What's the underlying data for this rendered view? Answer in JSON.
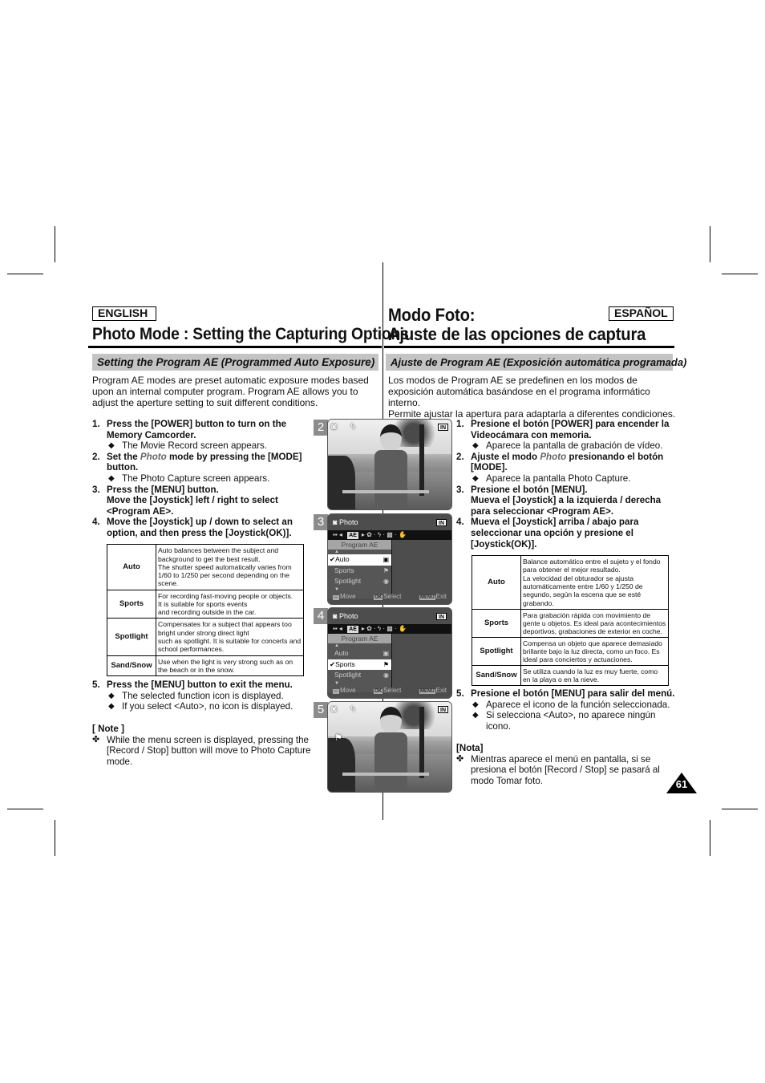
{
  "english": {
    "lang_label": "ENGLISH",
    "title": "Photo Mode : Setting the Capturing Options",
    "section": "Setting the Program AE (Programmed Auto Exposure)",
    "intro": "Program AE modes are preset automatic exposure modes based upon an internal computer program. Program AE allows you to adjust the aperture setting to suit different conditions.",
    "steps": [
      {
        "num": "1.",
        "text": "Press the [POWER] button to turn on the Memory Camcorder.",
        "bullets": [
          "The Movie Record screen appears."
        ]
      },
      {
        "num": "2.",
        "text_pre": "Set the ",
        "photo_word": "Photo",
        "text_post": " mode by pressing the [MODE] button.",
        "bullets": [
          "The Photo Capture screen appears."
        ]
      },
      {
        "num": "3.",
        "text": "Press the [MENU] button.",
        "text2": "Move the [Joystick] left / right to select <Program AE>.",
        "bullets": []
      },
      {
        "num": "4.",
        "text": "Move the [Joystick] up / down to select an option, and then press the [Joystick(OK)].",
        "bullets": []
      },
      {
        "num": "5.",
        "text": "Press the [MENU] button to exit the menu.",
        "bullets": [
          "The selected function icon is displayed.",
          "If you select <Auto>, no icon is displayed."
        ]
      }
    ],
    "modes": [
      {
        "name": "Auto",
        "desc": "Auto balances between the subject and background to get the best result.\nThe shutter speed automatically varies from 1/60 to 1/250 per second depending on the scene."
      },
      {
        "name": "Sports",
        "desc": "For recording fast-moving people or objects.\nIt is suitable for sports events\nand recording outside in the car."
      },
      {
        "name": "Spotlight",
        "desc": "Compensates for a subject that appears too bright under strong direct light\nsuch as spotlight. It is suitable for concerts and school performances."
      },
      {
        "name": "Sand/Snow",
        "desc": "Use when the light is very strong such as on the beach or in the snow."
      }
    ],
    "note_heading": "[ Note ]",
    "note_text": "While the menu screen is displayed, pressing the [Record / Stop] button will move to Photo Capture mode."
  },
  "spanish": {
    "lang_label": "ESPAÑOL",
    "title_line1": "Modo Foto:",
    "title_line2": "Ajuste de las opciones de captura",
    "section": "Ajuste de Program AE (Exposición automática programada)",
    "intro": "Los modos de Program AE se predefinen en los modos de exposición automática basándose en el programa informático interno.\nPermite ajustar la apertura para adaptarla a diferentes condiciones.",
    "steps": [
      {
        "num": "1.",
        "text": "Presione el botón [POWER] para encender la Videocámara con memoria.",
        "bullets": [
          "Aparece la pantalla de grabación de vídeo."
        ]
      },
      {
        "num": "2.",
        "text_pre": "Ajuste el modo ",
        "photo_word": "Photo",
        "text_post": " presionando el botón [MODE].",
        "bullets": [
          "Aparece la pantalla Photo Capture."
        ]
      },
      {
        "num": "3.",
        "text": "Presione el botón [MENU].",
        "text2": "Mueva el [Joystick] a la izquierda / derecha para seleccionar <Program AE>.",
        "bullets": []
      },
      {
        "num": "4.",
        "text": "Mueva el [Joystick] arriba / abajo para seleccionar una opción y presione el [Joystick(OK)].",
        "bullets": []
      },
      {
        "num": "5.",
        "text": "Presione el botón [MENU] para salir del menú.",
        "bullets": [
          "Aparece el icono de la función seleccionada.",
          "Si selecciona <Auto>, no aparece ningún icono."
        ]
      }
    ],
    "modes": [
      {
        "name": "Auto",
        "desc": "Balance automático entre el sujeto y el fondo para obtener el mejor resultado.\nLa velocidad del obturador se ajusta automáticamente entre 1/60 y 1/250 de segundo, según la escena que se esté grabando."
      },
      {
        "name": "Sports",
        "desc": "Para grabación rápida con movimiento de gente u objetos. Es ideal para acontecimientos deportivos, grabaciones de exterior en coche."
      },
      {
        "name": "Spotlight",
        "desc": "Compensa un objeto que aparece demasiado brillante bajo la luz directa, como un foco. Es ideal para conciertos y actuaciones."
      },
      {
        "name": "Sand/Snow",
        "desc": "Se utiliza cuando la luz es muy fuerte, como en la playa o en la nieve."
      }
    ],
    "note_heading": "[Nota]",
    "note_text": "Mientras aparece el menú en pantalla, si se presiona el botón [Record / Stop] se pasará al modo Tomar foto."
  },
  "screens": {
    "s2": {
      "num": "2",
      "battery": "IN"
    },
    "s3": {
      "num": "3",
      "mode_label": "Photo",
      "battery": "IN",
      "ae_label": "AE",
      "menu_title": "Program AE",
      "items": [
        "Auto",
        "Sports",
        "Spotlight"
      ],
      "selected": "Auto",
      "check": "✔",
      "move": "Move",
      "select_key": "OK",
      "select": "Select",
      "exit_key": "MENU",
      "exit": "Exit"
    },
    "s4": {
      "num": "4",
      "mode_label": "Photo",
      "battery": "IN",
      "ae_label": "AE",
      "menu_title": "Program AE",
      "items": [
        "Auto",
        "Sports",
        "Spotlight"
      ],
      "selected": "Sports",
      "check": "✔",
      "move": "Move",
      "select_key": "OK",
      "select": "Select",
      "exit_key": "MENU",
      "exit": "Exit"
    },
    "s5": {
      "num": "5",
      "battery": "IN"
    }
  },
  "icons": {
    "bullet": "◆",
    "note": "✤",
    "camera": "📷",
    "flash": "⚡"
  },
  "page_number": "61"
}
